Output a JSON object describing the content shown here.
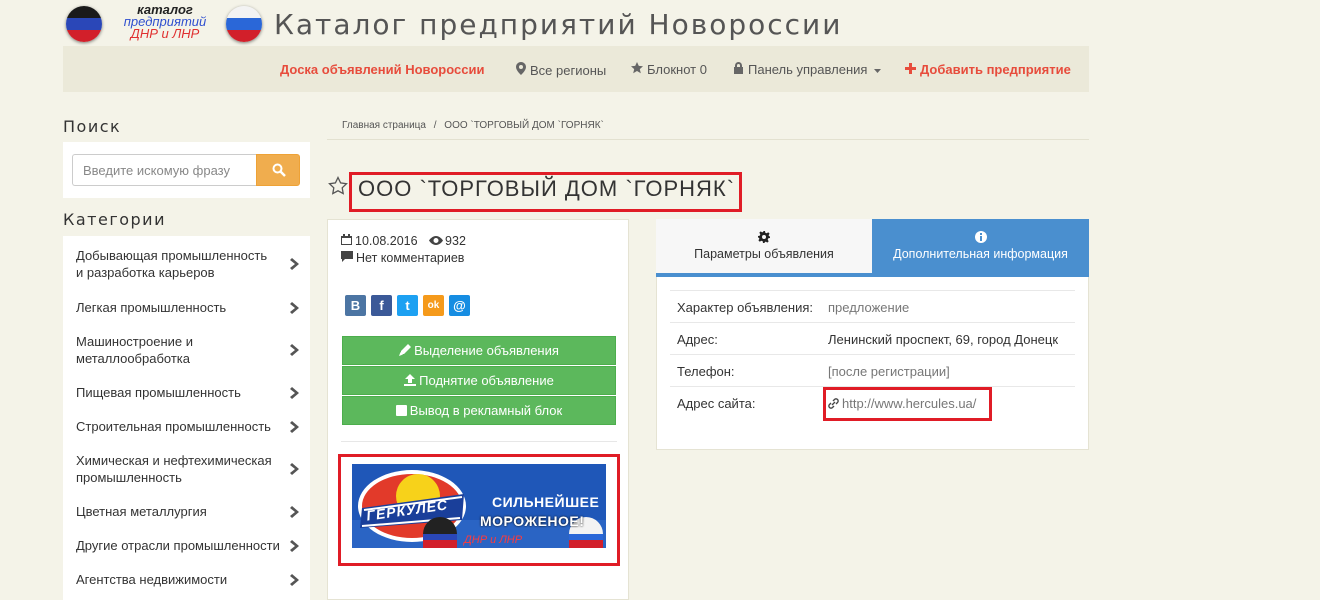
{
  "header": {
    "logo_line1": "каталог",
    "logo_line2": "предприятий",
    "logo_line3": "ДНР и ЛНР",
    "site_title": "Каталог предприятий Новороссии"
  },
  "nav": {
    "board": "Доска объявлений Новороссии",
    "regions": "Все регионы",
    "notebook": "Блокнот 0",
    "panel": "Панель управления",
    "add": "Добавить предприятие"
  },
  "sidebar": {
    "search_heading": "Поиск",
    "search_placeholder": "Введите искомую фразу",
    "categories_heading": "Категории",
    "categories": [
      "Добывающая промышленность и разработка карьеров",
      "Легкая промышленность",
      "Машиностроение и металлообработка",
      "Пищевая промышленность",
      "Строительная промышленность",
      "Химическая и нефтехимическая промышленность",
      "Цветная металлургия",
      "Другие отрасли промышленности",
      "Агентства недвижимости"
    ]
  },
  "breadcrumb": {
    "home": "Главная страница",
    "separator": "/",
    "current": "ООО `ТОРГОВЫЙ ДОМ `ГОРНЯК`"
  },
  "listing": {
    "title": "ООО `ТОРГОВЫЙ ДОМ `ГОРНЯК`",
    "date": "10.08.2016",
    "views": "932",
    "comments": "Нет комментариев",
    "share_labels": [
      "В",
      "f",
      "t",
      "ok",
      "@"
    ],
    "actions": [
      "Выделение объявления",
      "Поднятие объявление",
      "Вывод в рекламный блок"
    ],
    "banner": {
      "brand": "ГЕРКУЛЕС",
      "line1": "СИЛЬНЕЙШЕЕ",
      "line2": "МОРОЖЕНОЕ!",
      "line3": "ДНР и ЛНР"
    }
  },
  "tabs": {
    "params": "Параметры объявления",
    "extra": "Дополнительная информация"
  },
  "details": {
    "rows": [
      {
        "label": "Характер объявления:",
        "value": "предложение"
      },
      {
        "label": "Адрес:",
        "value": "Ленинский проспект, 69, город Донецк"
      },
      {
        "label": "Телефон:",
        "value": "[после регистрации]"
      },
      {
        "label": "Адрес сайта:",
        "value": "http://www.hercules.ua/"
      }
    ]
  },
  "colors": {
    "accent_red": "#e74c3c",
    "highlight_red": "#e01c26",
    "tab_blue": "#4a8fcf",
    "button_green": "#5cb85c",
    "search_orange": "#f0ad4e"
  }
}
